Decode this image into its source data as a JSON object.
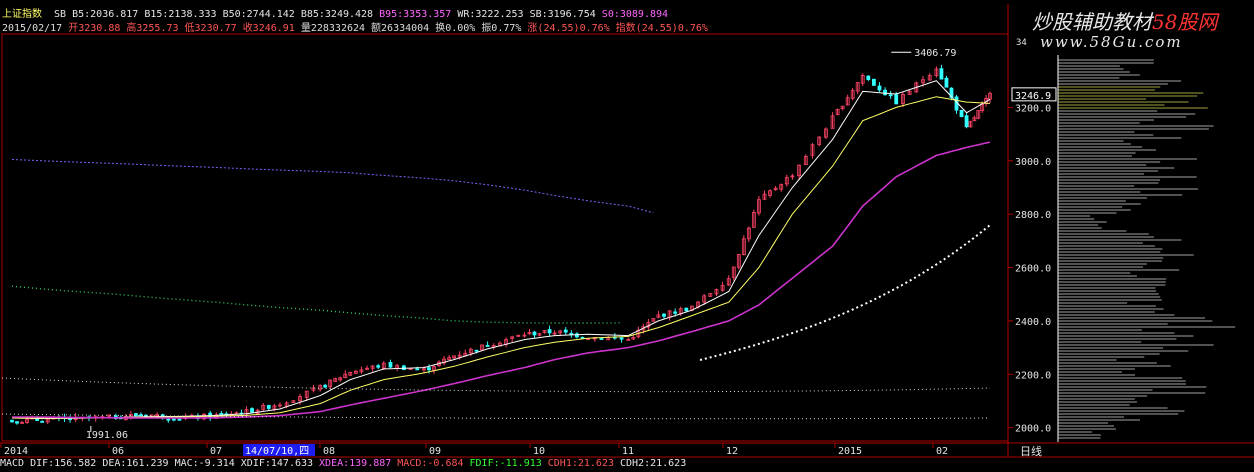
{
  "header": {
    "index_name": "上证指数",
    "ma_items": [
      {
        "label": "SB",
        "value": "B5:2036.817",
        "color": "#e6e6e6"
      },
      {
        "label": "",
        "value": "B15:2138.333",
        "color": "#e6e6e6"
      },
      {
        "label": "",
        "value": "B50:2744.142",
        "color": "#e6e6e6"
      },
      {
        "label": "",
        "value": "B85:3249.428",
        "color": "#e6e6e6"
      },
      {
        "label": "",
        "value": "B95:3353.357",
        "color": "#ff66ff"
      },
      {
        "label": "",
        "value": "WR:3222.253",
        "color": "#e6e6e6"
      },
      {
        "label": "",
        "value": "SB:3196.754",
        "color": "#e6e6e6"
      },
      {
        "label": "",
        "value": "S0:3089.894",
        "color": "#ff66ff"
      }
    ],
    "quote": [
      {
        "text": "2015/02/17",
        "color": "#dddddd"
      },
      {
        "text": "开3230.88",
        "color": "#ff5555"
      },
      {
        "text": "高3255.73",
        "color": "#ff5555"
      },
      {
        "text": "低3230.77",
        "color": "#ff5555"
      },
      {
        "text": "收3246.91",
        "color": "#ff5555"
      },
      {
        "text": "量228332624",
        "color": "#dddddd"
      },
      {
        "text": "额26334004",
        "color": "#dddddd"
      },
      {
        "text": "换0.00%",
        "color": "#dddddd"
      },
      {
        "text": "振0.77%",
        "color": "#dddddd"
      },
      {
        "text": "涨(24.55)0.76%",
        "color": "#ff5555"
      },
      {
        "text": "指数(24.55)0.76%",
        "color": "#ff5555"
      }
    ]
  },
  "brand": {
    "name_part1": "炒股辅助教材",
    "name_part2": "58股网",
    "site": "www.58Gu.com"
  },
  "price_axis": {
    "ticks": [
      "3200.0",
      "3000.0",
      "2800.0",
      "2600.0",
      "2400.0",
      "2200.0",
      "2000.0"
    ],
    "ticks_values": [
      3200,
      3000,
      2800,
      2600,
      2400,
      2200,
      2000
    ],
    "top_label": "34",
    "current_price": "3246.9"
  },
  "time_axis": {
    "labels": [
      "2014",
      "06",
      "07",
      "14/07/10,四",
      "08",
      "09",
      "10",
      "11",
      "12",
      "2015",
      "02"
    ],
    "period_label": "日线"
  },
  "annotations": {
    "high": "3406.79",
    "low": "1991.06"
  },
  "indicators": [
    {
      "text": "MACD DIF:156.582",
      "color": "#e6e6e6"
    },
    {
      "text": "DEA:161.239",
      "color": "#e6e6e6"
    },
    {
      "text": "MAC:-9.314",
      "color": "#e6e6e6"
    },
    {
      "text": "XDIF:147.633",
      "color": "#e6e6e6"
    },
    {
      "text": "XDEA:139.887",
      "color": "#ff66ff"
    },
    {
      "text": "MACD:-0.684",
      "color": "#ff5555"
    },
    {
      "text": "FDIF:-11.913",
      "color": "#33ff33"
    },
    {
      "text": "CDH1:21.623",
      "color": "#ff5555"
    },
    {
      "text": "CDH2:21.623",
      "color": "#e6e6e6"
    }
  ],
  "chart_data": {
    "type": "line",
    "title": "上证指数",
    "ylim": [
      1950,
      3460
    ],
    "x": [
      "2014-05-01",
      "2014-05-10",
      "2014-05-20",
      "2014-06-01",
      "2014-06-10",
      "2014-06-20",
      "2014-07-01",
      "2014-07-10",
      "2014-07-20",
      "2014-08-01",
      "2014-08-10",
      "2014-08-20",
      "2014-09-01",
      "2014-09-10",
      "2014-09-20",
      "2014-10-01",
      "2014-10-10",
      "2014-10-20",
      "2014-11-01",
      "2014-11-10",
      "2014-11-20",
      "2014-12-01",
      "2014-12-10",
      "2014-12-20",
      "2015-01-01",
      "2015-01-10",
      "2015-01-20",
      "2015-02-01",
      "2015-02-10",
      "2015-02-17"
    ],
    "series": [
      {
        "name": "收",
        "values": [
          2025,
          2030,
          2032,
          2040,
          2050,
          2035,
          2045,
          2060,
          2090,
          2150,
          2210,
          2235,
          2215,
          2270,
          2310,
          2350,
          2360,
          2340,
          2330,
          2420,
          2450,
          2560,
          2850,
          2950,
          3160,
          3320,
          3220,
          3350,
          3120,
          3247
        ]
      },
      {
        "name": "B5",
        "values": [
          2036,
          2034,
          2035,
          2038,
          2041,
          2042,
          2046,
          2052,
          2070,
          2120,
          2180,
          2220,
          2225,
          2255,
          2295,
          2330,
          2345,
          2350,
          2345,
          2400,
          2440,
          2510,
          2720,
          2900,
          3080,
          3260,
          3250,
          3300,
          3180,
          3230
        ]
      },
      {
        "name": "B15",
        "values": [
          2036,
          2036,
          2036,
          2037,
          2039,
          2040,
          2043,
          2046,
          2056,
          2090,
          2140,
          2180,
          2205,
          2230,
          2265,
          2300,
          2320,
          2335,
          2342,
          2375,
          2420,
          2470,
          2600,
          2800,
          2980,
          3150,
          3200,
          3240,
          3220,
          3215
        ]
      },
      {
        "name": "B50",
        "values": [
          2040,
          2040,
          2038,
          2037,
          2036,
          2036,
          2037,
          2040,
          2045,
          2060,
          2085,
          2110,
          2140,
          2165,
          2195,
          2225,
          2255,
          2280,
          2300,
          2325,
          2360,
          2400,
          2460,
          2560,
          2680,
          2830,
          2940,
          3020,
          3050,
          3070
        ]
      },
      {
        "name": "B95",
        "values": [
          3005,
          3000,
          2995,
          2990,
          2985,
          2980,
          2975,
          2970,
          2965,
          2960,
          2955,
          2945,
          2935,
          2925,
          2910,
          2890,
          2870,
          2850,
          2830,
          2800,
          null,
          null,
          null,
          null,
          null,
          null,
          null,
          null,
          null,
          null
        ]
      },
      {
        "name": "S0",
        "values": [
          2530,
          2520,
          2510,
          2500,
          2490,
          2480,
          2470,
          2460,
          2450,
          2440,
          2430,
          2420,
          2410,
          2400,
          2395,
          2393,
          2392,
          2392,
          2393,
          null,
          null,
          null,
          null,
          null,
          null,
          null,
          null,
          null,
          null,
          null
        ]
      }
    ]
  }
}
